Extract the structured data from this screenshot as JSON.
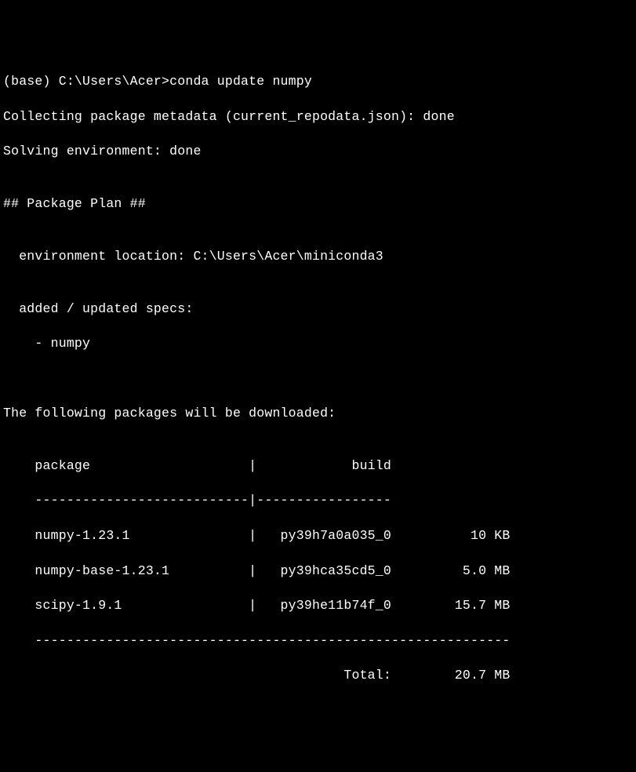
{
  "prompt_line": "(base) C:\\Users\\Acer>conda update numpy",
  "collecting": "Collecting package metadata (current_repodata.json): done",
  "solving": "Solving environment: done",
  "blank": "",
  "plan_header": "## Package Plan ##",
  "env_location": "  environment location: C:\\Users\\Acer\\miniconda3",
  "added_specs": "  added / updated specs:",
  "spec1": "    - numpy",
  "downloads_heading": "The following packages will be downloaded:",
  "table_header": "    package                    |            build",
  "table_divider": "    ---------------------------|-----------------",
  "row1": "    numpy-1.23.1               |   py39h7a0a035_0          10 KB",
  "row2": "    numpy-base-1.23.1          |   py39hca35cd5_0         5.0 MB",
  "row3": "    scipy-1.9.1                |   py39he11b74f_0        15.7 MB",
  "table_bottom": "    ------------------------------------------------------------",
  "total": "                                           Total:        20.7 MB"
}
